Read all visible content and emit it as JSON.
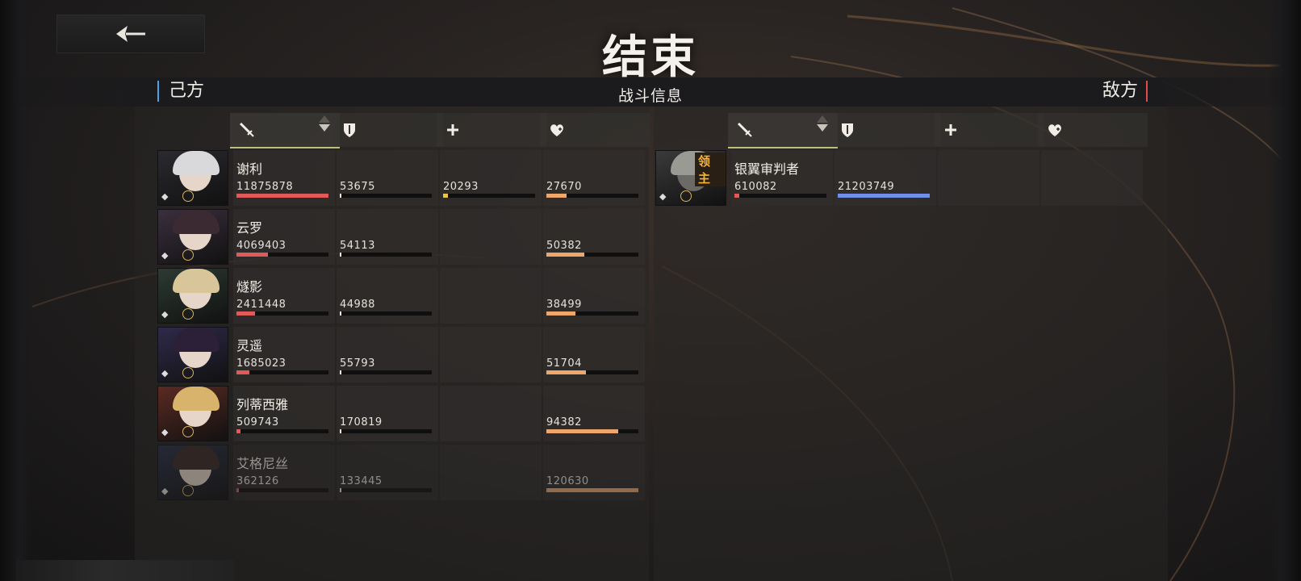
{
  "title": "结束",
  "subtitle": "战斗信息",
  "ally_label": "己方",
  "enemy_label": "敌方",
  "colors": {
    "damage_bar": "#e05a5a",
    "tank_bar": "#e8e4de",
    "heal_bar": "#e9c44f",
    "shield_bar": "#efa66a",
    "boss_taken_bar": "#6f8fe8",
    "ally_accent": "#4aa3e8",
    "enemy_accent": "#e14a4a",
    "boss_tag": "#f5b43a"
  },
  "columns": [
    {
      "icon": "sword-icon",
      "sorted": true
    },
    {
      "icon": "shield-icon",
      "sorted": false
    },
    {
      "icon": "plus-heal-icon",
      "sorted": false
    },
    {
      "icon": "heart-shield-icon",
      "sorted": false
    }
  ],
  "allies": [
    {
      "name": "谢利",
      "damage": "11875878",
      "taken": "53675",
      "heal": "20293",
      "shield": "27670",
      "bars": [
        1.0,
        0.0,
        0.05,
        0.22
      ]
    },
    {
      "name": "云罗",
      "damage": "4069403",
      "taken": "54113",
      "heal": "",
      "shield": "50382",
      "bars": [
        0.34,
        0.0,
        0,
        0.41
      ]
    },
    {
      "name": "燧影",
      "damage": "2411448",
      "taken": "44988",
      "heal": "",
      "shield": "38499",
      "bars": [
        0.2,
        0.0,
        0,
        0.32
      ]
    },
    {
      "name": "灵遥",
      "damage": "1685023",
      "taken": "55793",
      "heal": "",
      "shield": "51704",
      "bars": [
        0.14,
        0.0,
        0,
        0.43
      ]
    },
    {
      "name": "列蒂西雅",
      "damage": "509743",
      "taken": "170819",
      "heal": "",
      "shield": "94382",
      "bars": [
        0.04,
        0.0,
        0,
        0.78
      ]
    },
    {
      "name": "艾格尼丝",
      "damage": "362126",
      "taken": "133445",
      "heal": "",
      "shield": "120630",
      "bars": [
        0.03,
        0.0,
        0,
        1.0
      ]
    }
  ],
  "enemies": [
    {
      "name": "银翼审判者",
      "tag": "领主",
      "damage": "610082",
      "taken": "21203749",
      "bars": [
        0.05,
        1.0
      ]
    }
  ]
}
